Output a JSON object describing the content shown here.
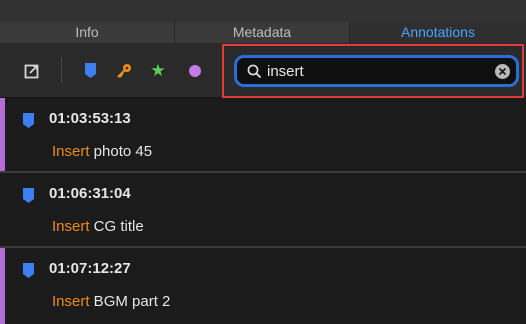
{
  "tabs": [
    {
      "label": "Info",
      "active": false
    },
    {
      "label": "Metadata",
      "active": false
    },
    {
      "label": "Annotations",
      "active": true
    }
  ],
  "toolbar": {
    "icons": [
      "export-icon",
      "blue-marker-icon",
      "key-icon",
      "star-icon",
      "dot-icon"
    ],
    "colors": {
      "blue": "#3b7ff0",
      "orange": "#f08c1a",
      "green": "#5ad14e",
      "purple": "#c57ae8"
    }
  },
  "search": {
    "value": "insert",
    "placeholder": "",
    "icon": "search-icon",
    "clear_icon": "clear-icon",
    "highlight_color": "#e23a3a"
  },
  "annotations": [
    {
      "timecode": "01:03:53:13",
      "keyword": "Insert",
      "text": " photo 45"
    },
    {
      "timecode": "01:06:31:04",
      "keyword": "Insert",
      "text": " CG title"
    },
    {
      "timecode": "01:07:12:27",
      "keyword": "Insert",
      "text": " BGM part 2"
    }
  ],
  "colors": {
    "accent": "#4aa3ff",
    "keyword": "#f08c1a",
    "row_accent": "#b46dd6"
  }
}
